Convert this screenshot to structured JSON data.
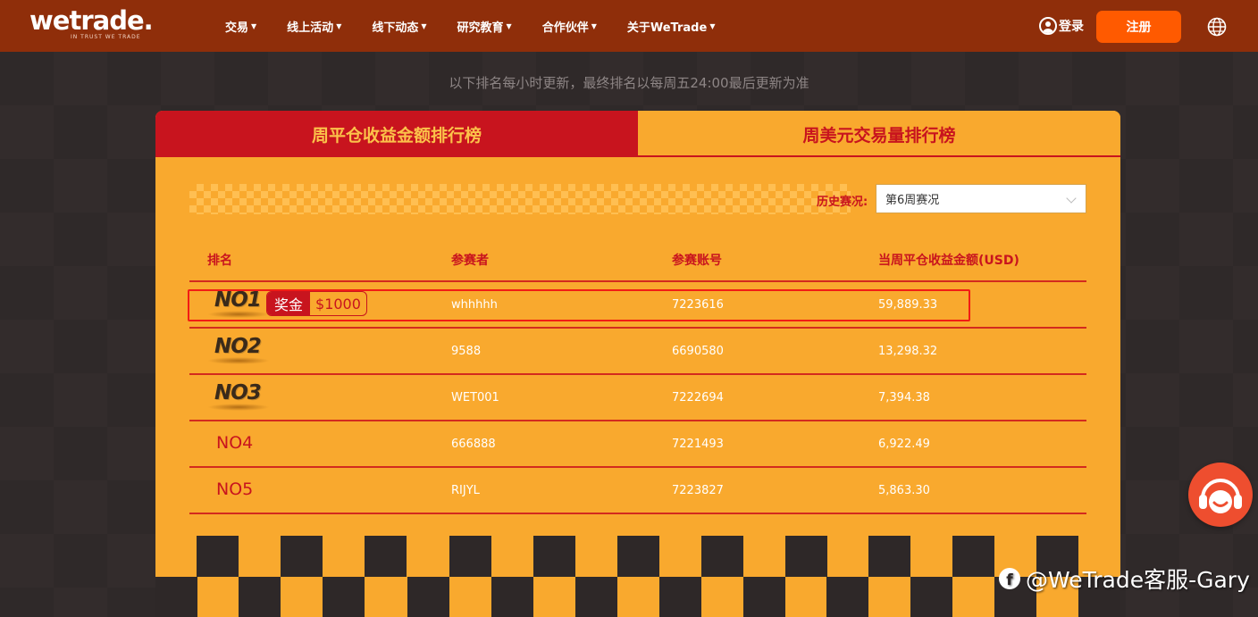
{
  "header": {
    "logo_text": "wetrade.",
    "logo_tagline": "IN TRUST WE TRADE",
    "nav": [
      {
        "label": "交易"
      },
      {
        "label": "线上活动"
      },
      {
        "label": "线下动态"
      },
      {
        "label": "研究教育"
      },
      {
        "label": "合作伙伴"
      },
      {
        "label": "关于WeTrade"
      }
    ],
    "login_label": "登录",
    "register_label": "注册",
    "icons": {
      "user": "user-icon",
      "globe": "globe-icon",
      "caret": "caret-down-icon"
    }
  },
  "notice": "以下排名每小时更新，最终排名以每周五24:00最后更新为准",
  "tabs": [
    {
      "label": "周平仓收益金额排行榜",
      "active": true
    },
    {
      "label": "周美元交易量排行榜",
      "active": false
    }
  ],
  "history": {
    "label": "历史赛况:",
    "selected": "第6周赛况"
  },
  "table": {
    "headers": [
      "排名",
      "参赛者",
      "参赛账号",
      "当周平仓收益金额(USD)"
    ],
    "rows": [
      {
        "rank": "NO1",
        "prize_label": "奖金",
        "prize_value": "$1000",
        "player": "whhhhh",
        "account": "7223616",
        "amount": "59,889.33"
      },
      {
        "rank": "NO2",
        "player": "9588",
        "account": "6690580",
        "amount": "13,298.32"
      },
      {
        "rank": "NO3",
        "player": "WET001",
        "account": "7222694",
        "amount": "7,394.38"
      },
      {
        "rank": "NO4",
        "player": "666888",
        "account": "7221493",
        "amount": "6,922.49"
      },
      {
        "rank": "NO5",
        "player": "RIJYL",
        "account": "7223827",
        "amount": "5,863.30"
      }
    ]
  },
  "watermark": "@WeTrade客服-Gary",
  "colors": {
    "header": "#8f2e0a",
    "accent": "#ff5a00",
    "panel": "#f9a92e",
    "red": "#c8141e"
  }
}
